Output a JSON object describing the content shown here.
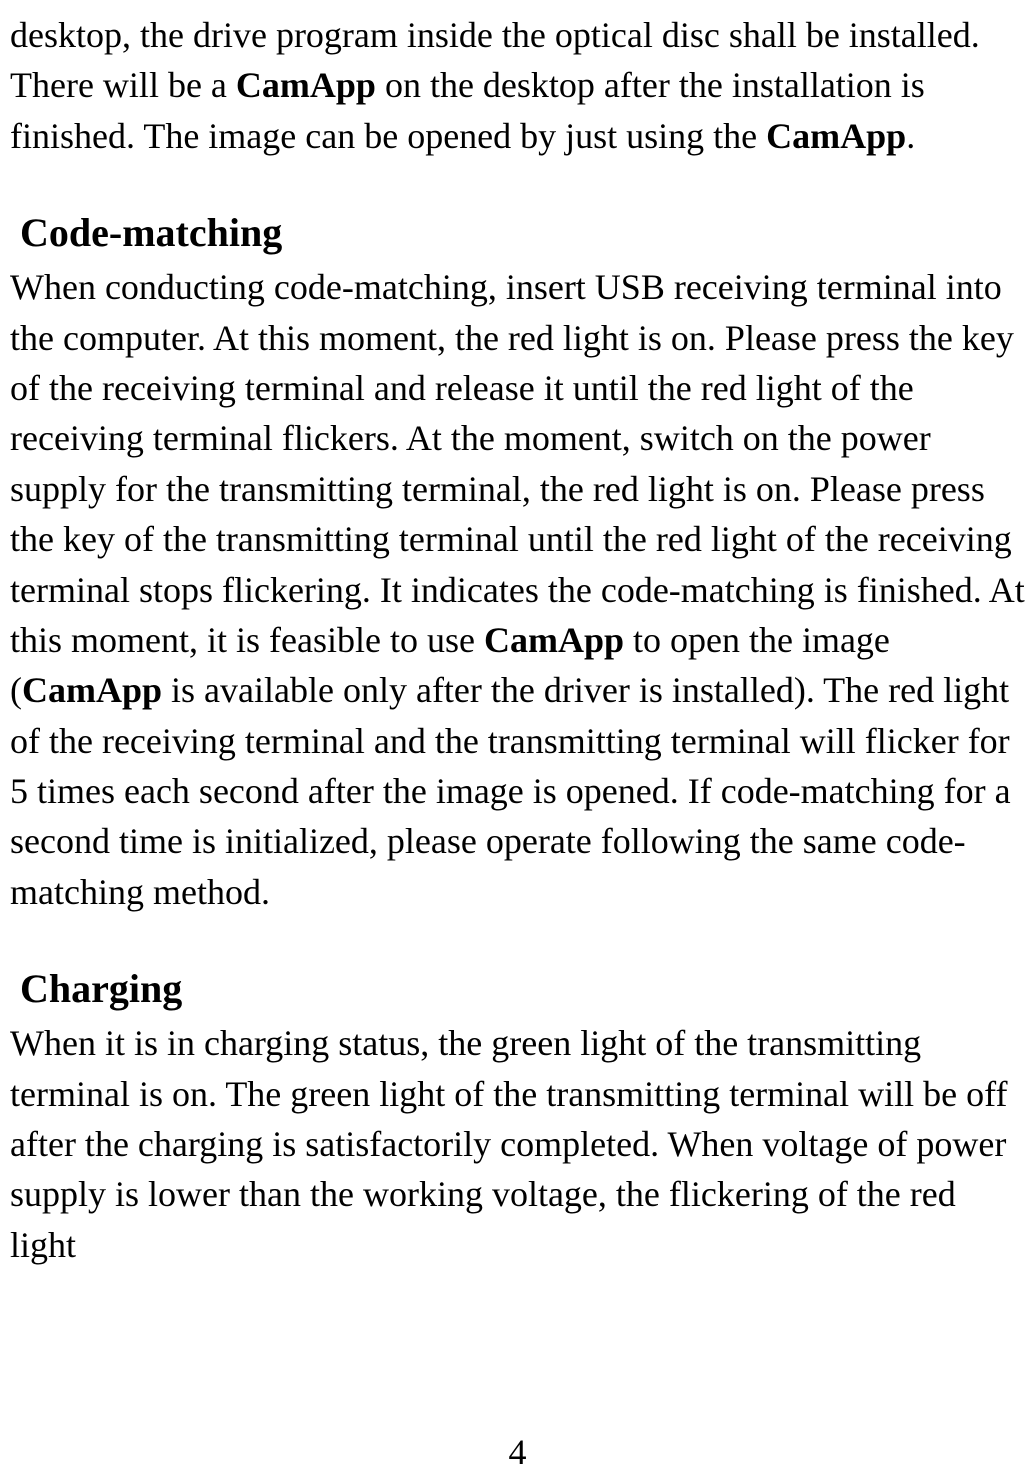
{
  "intro": {
    "text_before_bold1": "desktop, the drive program inside the optical disc shall be installed. There will be a ",
    "bold1": "CamApp",
    "text_mid": " on the desktop after the installation is finished. The image can be opened by just using the ",
    "bold2": "CamApp",
    "text_after": "."
  },
  "section1": {
    "heading": "Code-matching",
    "para_text1": "When conducting code-matching, insert USB receiving terminal into the computer. At this moment, the red light is on. Please press the key of the receiving terminal and release it until the red light of the receiving terminal flickers. At the moment, switch on the power supply for the transmitting terminal, the red light is on. Please press the key of the transmitting terminal until the red light of the receiving terminal stops flickering. It indicates the code-matching is finished. At this moment, it is feasible to use ",
    "bold1": "CamApp",
    "para_text2": " to open the image (",
    "bold2": "CamApp",
    "para_text3": " is available only after the driver is installed). The red light of the receiving terminal and the transmitting terminal will flicker for 5 times each second after the image is opened. If code-matching for a second time is initialized, please operate following the same code-matching method."
  },
  "section2": {
    "heading": "Charging",
    "para": "When it is in charging status, the green light of the transmitting terminal is on. The green light of the transmitting terminal will be off after the charging is satisfactorily completed. When voltage of power supply is lower than the working voltage, the flickering of the red light"
  },
  "page_number": "4"
}
